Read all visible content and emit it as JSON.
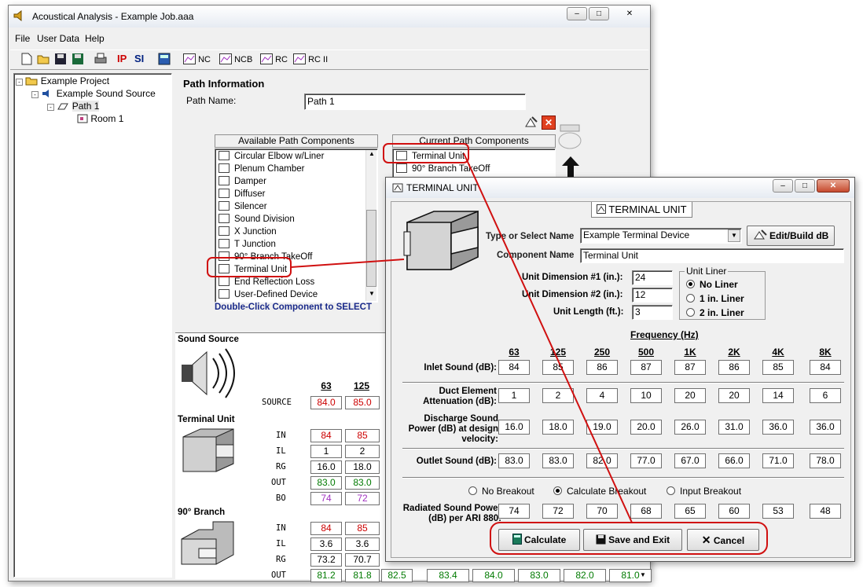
{
  "main_window": {
    "title": "Acoustical Analysis - Example Job.aaa",
    "menu": [
      "File",
      "User Data",
      "Help"
    ],
    "toolbar": {
      "ip": "IP",
      "si": "SI",
      "nc": "NC",
      "ncb": "NCB",
      "rc": "RC",
      "rc2": "RC II"
    },
    "tree": {
      "project": "Example Project",
      "source": "Example Sound Source",
      "path": "Path 1",
      "room": "Room 1"
    },
    "path_info": {
      "heading": "Path Information",
      "name_label": "Path Name:",
      "name_value": "Path 1",
      "available_header": "Available Path Components",
      "current_header": "Current Path Components",
      "available": [
        "Circular Elbow w/Liner",
        "Plenum Chamber",
        "Damper",
        "Diffuser",
        "Silencer",
        "Sound Division",
        "X Junction",
        "T Junction",
        "90° Branch TakeOff",
        "Terminal Unit",
        "End Reflection Loss",
        "User-Defined Device"
      ],
      "current": [
        "Terminal Unit",
        "90° Branch TakeOff"
      ],
      "hint": "Double-Click Component to SELECT"
    },
    "sound_source": {
      "label": "Sound Source",
      "freqs": [
        "63",
        "125"
      ],
      "row_label": "SOURCE",
      "values": [
        "84.0",
        "85.0"
      ]
    },
    "terminal_unit": {
      "label": "Terminal Unit",
      "rows": [
        {
          "label": "IN",
          "values": [
            "84",
            "85"
          ],
          "color": "red"
        },
        {
          "label": "IL",
          "values": [
            "1",
            "2"
          ],
          "color": "black"
        },
        {
          "label": "RG",
          "values": [
            "16.0",
            "18.0"
          ],
          "color": "black"
        },
        {
          "label": "OUT",
          "values": [
            "83.0",
            "83.0"
          ],
          "color": "green"
        },
        {
          "label": "BO",
          "values": [
            "74",
            "72"
          ],
          "color": "purple"
        }
      ]
    },
    "branch": {
      "label": "90° Branch",
      "rows": [
        {
          "label": "IN",
          "values": [
            "84",
            "85"
          ],
          "color": "red"
        },
        {
          "label": "IL",
          "values": [
            "3.6",
            "3.6"
          ],
          "color": "black"
        },
        {
          "label": "RG",
          "values": [
            "73.2",
            "70.7"
          ],
          "color": "black"
        },
        {
          "label": "OUT",
          "values": [
            "81.2",
            "81.8",
            "82.5",
            "83.4",
            "84.0",
            "83.0",
            "82.0",
            "81.0"
          ],
          "color": "green"
        }
      ]
    }
  },
  "dialog": {
    "title": "TERMINAL UNIT",
    "tab": "TERMINAL UNIT",
    "type_label": "Type or Select Name",
    "type_value": "Example Terminal Device",
    "edit_button": "Edit/Build dB",
    "component_label": "Component Name",
    "component_value": "Terminal Unit",
    "dim1_label": "Unit Dimension #1 (in.):",
    "dim1_value": "24",
    "dim2_label": "Unit Dimension #2 (in.):",
    "dim2_value": "12",
    "length_label": "Unit Length (ft.):",
    "length_value": "3",
    "liner_title": "Unit Liner",
    "liner_options": [
      "No Liner",
      "1 in. Liner",
      "2 in. Liner"
    ],
    "liner_selected": 0,
    "freq_title": "Frequency (Hz)",
    "freqs": [
      "63",
      "125",
      "250",
      "500",
      "1K",
      "2K",
      "4K",
      "8K"
    ],
    "rows": [
      {
        "label": "Inlet Sound (dB):",
        "values": [
          "84",
          "85",
          "86",
          "87",
          "87",
          "86",
          "85",
          "84"
        ]
      },
      {
        "label": "Duct Element Attenuation (dB):",
        "values": [
          "1",
          "2",
          "4",
          "10",
          "20",
          "20",
          "14",
          "6"
        ]
      },
      {
        "label": "Discharge Sound Power (dB) at design velocity:",
        "values": [
          "16.0",
          "18.0",
          "19.0",
          "20.0",
          "26.0",
          "31.0",
          "36.0",
          "36.0"
        ]
      },
      {
        "label": "Outlet Sound (dB):",
        "values": [
          "83.0",
          "83.0",
          "82.0",
          "77.0",
          "67.0",
          "66.0",
          "71.0",
          "78.0"
        ]
      }
    ],
    "breakout_options": [
      "No Breakout",
      "Calculate Breakout",
      "Input Breakout"
    ],
    "breakout_selected": 1,
    "radiated_label": "Radiated Sound Power (dB) per ARI 880:",
    "radiated_values": [
      "74",
      "72",
      "70",
      "68",
      "65",
      "60",
      "53",
      "48"
    ],
    "buttons": {
      "calculate": "Calculate",
      "save": "Save and Exit",
      "cancel": "Cancel"
    }
  }
}
